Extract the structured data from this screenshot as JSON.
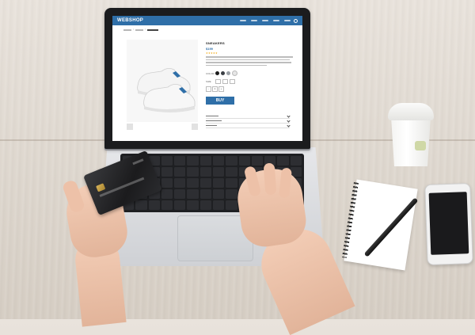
{
  "scene": "laptop-online-shopping",
  "website": {
    "logo": "WEBSHOP",
    "product": {
      "name": "SNEAKERS",
      "price": "$199",
      "buy_label": "BUY",
      "rating": "★★★★★",
      "color_label": "COLOR",
      "size_label": "SIZE",
      "quantity": "1",
      "swatch_colors": [
        "#1c1c1c",
        "#3b3f45",
        "#9aa0a6",
        "#e6e6e6"
      ]
    },
    "brand_color": "#2f6fa8"
  },
  "card": {
    "color": "#1e1f21"
  }
}
